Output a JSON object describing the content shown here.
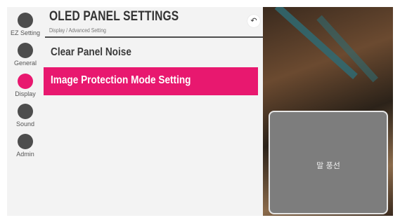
{
  "nav": {
    "items": [
      {
        "label": "EZ Setting"
      },
      {
        "label": "General"
      },
      {
        "label": "Display"
      },
      {
        "label": "Sound"
      },
      {
        "label": "Admin"
      }
    ]
  },
  "header": {
    "title": "OLED PANEL SETTINGS",
    "breadcrumb": "Display / Advanced Setting",
    "back_icon": "↶"
  },
  "menu": {
    "items": [
      {
        "label": "Clear Panel Noise"
      },
      {
        "label": "Image Protection Mode Setting"
      }
    ]
  },
  "preview": {
    "bubble_text": "말 풍선"
  },
  "colors": {
    "accent": "#e8186f",
    "nav_dot": "#4d4d4d"
  }
}
